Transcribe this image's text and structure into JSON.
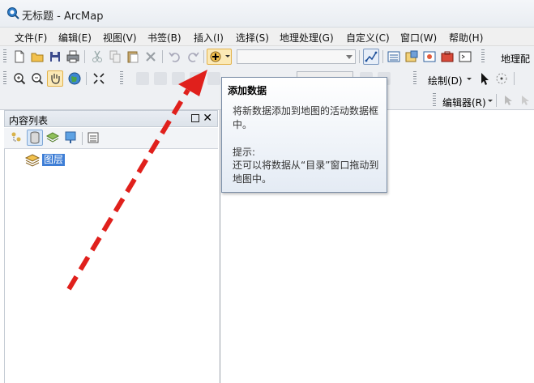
{
  "window": {
    "title": "无标题 - ArcMap"
  },
  "menu": {
    "items": [
      "文件(F)",
      "编辑(E)",
      "视图(V)",
      "书签(B)",
      "插入(I)",
      "选择(S)",
      "地理处理(G)",
      "自定义(C)",
      "窗口(W)",
      "帮助(H)"
    ]
  },
  "toolbar": {
    "geoprocessing_label": "地理配",
    "draw_label": "绘制(D)",
    "editor_label": "编辑器(R)"
  },
  "toc": {
    "title": "内容列表",
    "close_glyph": "✕",
    "layer_name": "图层"
  },
  "tooltip": {
    "title": "添加数据",
    "body": "将新数据添加到地图的活动数据框中。",
    "hint_label": "提示:",
    "hint": "还可以将数据从“目录”窗口拖动到地图中。"
  },
  "colors": {
    "annotation_arrow": "#e0201c",
    "selection": "#3e7ed6",
    "pressed_button": "#fbe9b6"
  }
}
